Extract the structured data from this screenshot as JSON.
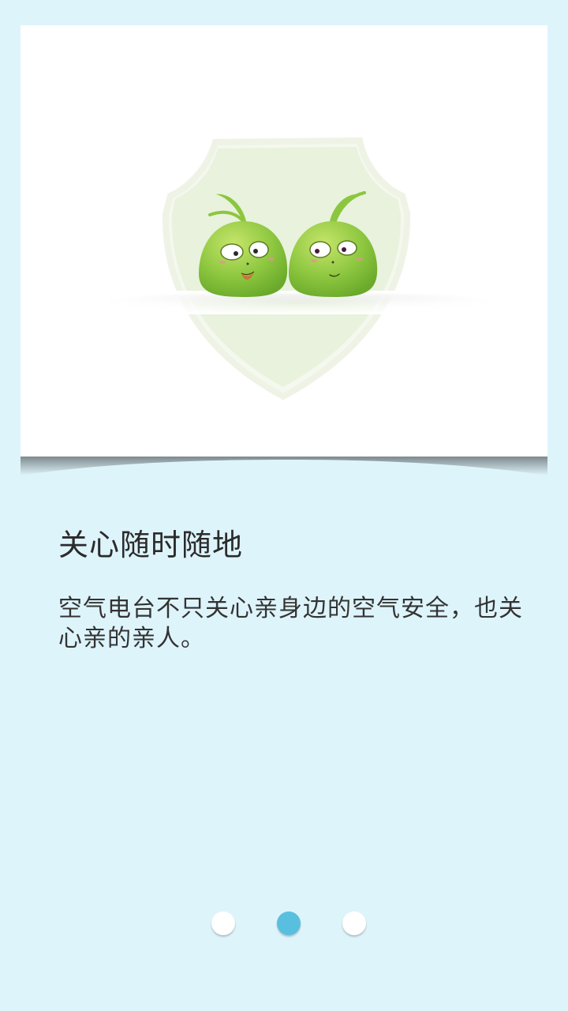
{
  "onboarding": {
    "title": "关心随时随地",
    "description": "空气电台不只关心亲身边的空气安全，也关心亲的亲人。",
    "illustration_icon": "shield-with-two-green-mascots-icon",
    "pager": {
      "total": 3,
      "current": 2,
      "active_color": "#58bfdf",
      "inactive_color": "#ffffff"
    },
    "colors": {
      "background": "#def4fb",
      "card": "#ffffff",
      "mascot": "#8cc63f",
      "shield": "#e8f2dc"
    }
  }
}
